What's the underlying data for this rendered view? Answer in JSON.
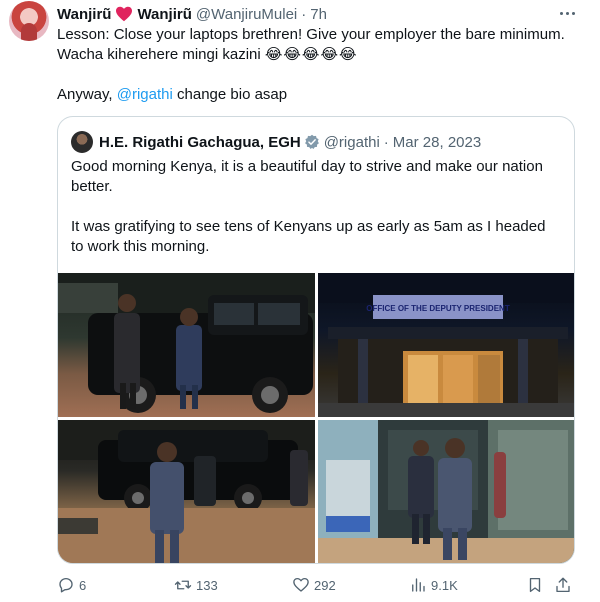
{
  "tweet": {
    "author": {
      "display_name_1": "Wanjirũ",
      "display_name_2": "Wanjirũ",
      "handle": "@WanjiruMulei",
      "time": "7h"
    },
    "text": {
      "line1": "Lesson: Close your laptops brethren! Give your employer the bare minimum. Wacha kiherehere mingi kazini",
      "emoji": "😂😂😂😂😂",
      "line2_prefix": "Anyway, ",
      "mention": "@rigathi",
      "line2_suffix": " change bio asap"
    },
    "quoted": {
      "display_name": "H.E. Rigathi Gachagua, EGH",
      "handle": "@rigathi",
      "separator": "·",
      "date": "Mar 28, 2023",
      "para1": "Good morning Kenya, it is a beautiful day to strive and make our nation better.",
      "para2": "It was gratifying to see tens of Kenyans up as early as 5am as I headed to work this morning.",
      "photo2_sign": "OFFICE OF THE DEPUTY PRESIDENT"
    },
    "stats": {
      "replies": "6",
      "retweets": "133",
      "likes": "292",
      "views": "9.1K"
    },
    "colors": {
      "accent": "#1d9bf0",
      "heart": "#e0245e",
      "secondary_text": "#536471"
    }
  }
}
